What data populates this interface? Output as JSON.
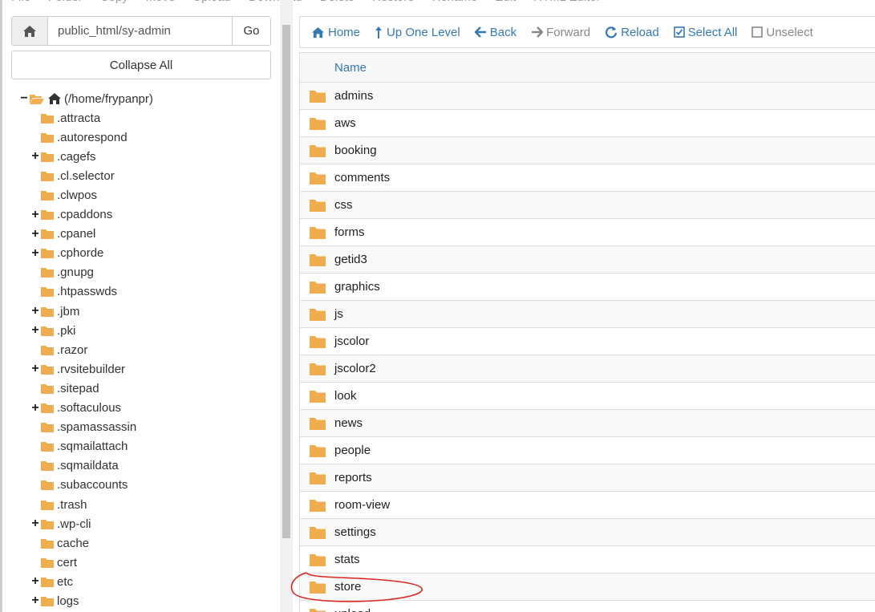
{
  "top_toolbar": [
    "File",
    "Folder",
    "Copy",
    "Move",
    "Upload",
    "Download",
    "Delete",
    "Restore",
    "Rename",
    "Edit",
    "HTML Editor"
  ],
  "path_bar": {
    "value": "public_html/sy-admin",
    "go_label": "Go"
  },
  "collapse_all_label": "Collapse All",
  "tree": {
    "root_label": "(/home/frypanpr)",
    "items": [
      {
        "label": ".attracta",
        "toggle": ""
      },
      {
        "label": ".autorespond",
        "toggle": ""
      },
      {
        "label": ".cagefs",
        "toggle": "+"
      },
      {
        "label": ".cl.selector",
        "toggle": ""
      },
      {
        "label": ".clwpos",
        "toggle": ""
      },
      {
        "label": ".cpaddons",
        "toggle": "+"
      },
      {
        "label": ".cpanel",
        "toggle": "+"
      },
      {
        "label": ".cphorde",
        "toggle": "+"
      },
      {
        "label": ".gnupg",
        "toggle": ""
      },
      {
        "label": ".htpasswds",
        "toggle": ""
      },
      {
        "label": ".jbm",
        "toggle": "+"
      },
      {
        "label": ".pki",
        "toggle": "+"
      },
      {
        "label": ".razor",
        "toggle": ""
      },
      {
        "label": ".rvsitebuilder",
        "toggle": "+"
      },
      {
        "label": ".sitepad",
        "toggle": ""
      },
      {
        "label": ".softaculous",
        "toggle": "+"
      },
      {
        "label": ".spamassassin",
        "toggle": ""
      },
      {
        "label": ".sqmailattach",
        "toggle": ""
      },
      {
        "label": ".sqmaildata",
        "toggle": ""
      },
      {
        "label": ".subaccounts",
        "toggle": ""
      },
      {
        "label": ".trash",
        "toggle": ""
      },
      {
        "label": ".wp-cli",
        "toggle": "+"
      },
      {
        "label": "cache",
        "toggle": ""
      },
      {
        "label": "cert",
        "toggle": ""
      },
      {
        "label": "etc",
        "toggle": "+"
      },
      {
        "label": "logs",
        "toggle": "+"
      }
    ]
  },
  "right_toolbar": {
    "home": "Home",
    "up_one_level": "Up One Level",
    "back": "Back",
    "forward": "Forward",
    "reload": "Reload",
    "select_all": "Select All",
    "unselect_all": "Unselect"
  },
  "table": {
    "name_header": "Name",
    "rows": [
      "admins",
      "aws",
      "booking",
      "comments",
      "css",
      "forms",
      "getid3",
      "graphics",
      "js",
      "jscolor",
      "jscolor2",
      "look",
      "news",
      "people",
      "reports",
      "room-view",
      "settings",
      "stats",
      "store",
      "upload"
    ]
  },
  "colors": {
    "folder": "#f0ad4e",
    "link": "#337ab7",
    "highlight": "#d9281f"
  }
}
